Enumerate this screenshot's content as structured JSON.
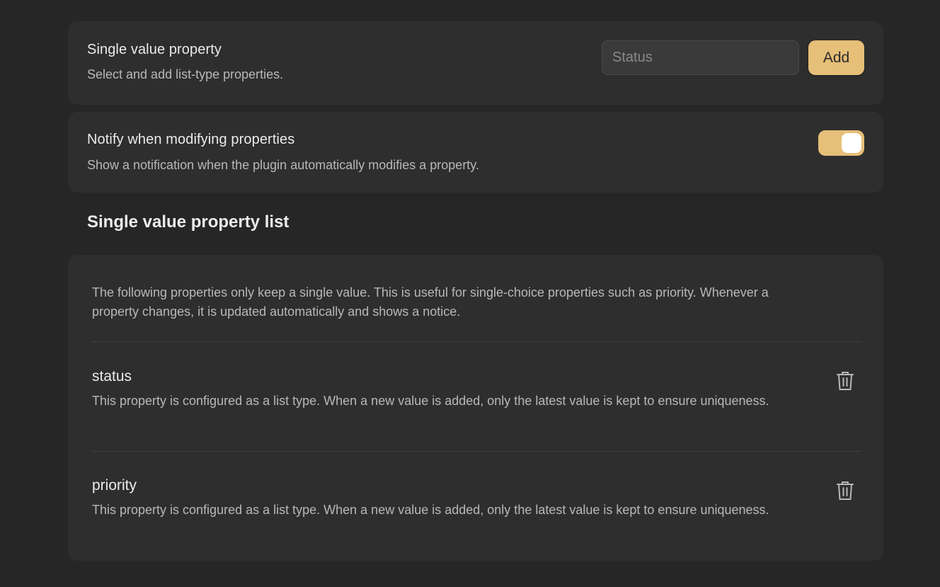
{
  "single_value_setting": {
    "title": "Single value property",
    "description": "Select and add list-type properties.",
    "input_placeholder": "Status",
    "input_value": "",
    "add_label": "Add"
  },
  "notify_setting": {
    "title": "Notify when modifying properties",
    "description": "Show a notification when the plugin automatically modifies a property.",
    "enabled": true
  },
  "property_list": {
    "heading": "Single value property list",
    "intro": "The following properties only keep a single value. This is useful for single-choice properties such as priority. Whenever a property changes, it is updated automatically and shows a notice.",
    "items": [
      {
        "name": "status",
        "description": "This property is configured as a list type. When a new value is added, only the latest value is kept to ensure uniqueness."
      },
      {
        "name": "priority",
        "description": "This property is configured as a list type. When a new value is added, only the latest value is kept to ensure uniqueness."
      }
    ]
  },
  "icons": {
    "delete": "trash-icon"
  },
  "colors": {
    "accent": "#e6bf78",
    "background": "#262626",
    "card": "#2e2e2e"
  }
}
